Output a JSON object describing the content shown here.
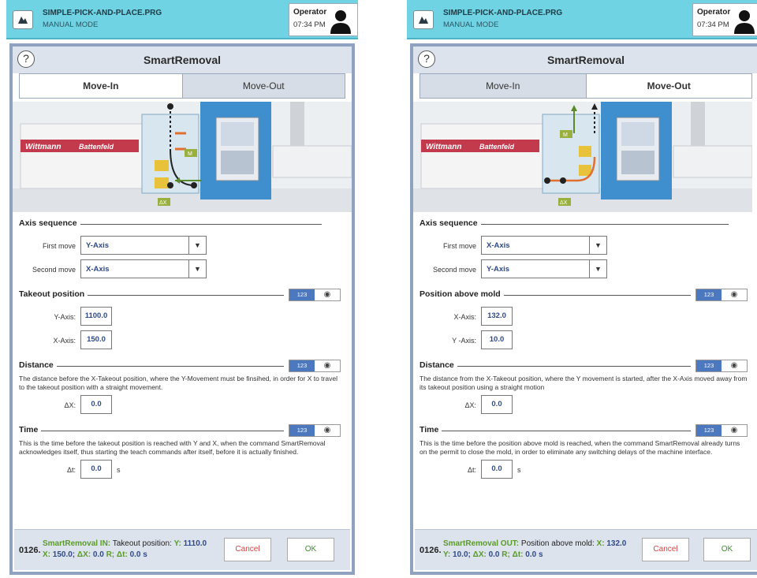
{
  "screens": [
    {
      "header": {
        "program": "SIMPLE-PICK-AND-PLACE.PRG",
        "mode": "MANUAL MODE",
        "role": "Operator",
        "time": "07:34 PM"
      },
      "dialog": {
        "title": "SmartRemoval",
        "help": "?",
        "tabs": [
          {
            "label": "Move-In",
            "active": true
          },
          {
            "label": "Move-Out",
            "active": false
          }
        ],
        "illustration": {
          "brand_left": "Wittmann",
          "brand_right": "Battenfeld",
          "marker_m": "M",
          "marker_dx": "ΔX"
        },
        "axis_sequence": {
          "heading": "Axis sequence",
          "first_label": "First move",
          "first_value": "Y-Axis",
          "second_label": "Second move",
          "second_value": "X-Axis"
        },
        "position": {
          "heading": "Takeout position",
          "toggle_a": "123",
          "toggle_b": "◉",
          "a_label": "Y-Axis:",
          "a_value": "1100.0",
          "b_label": "X-Axis:",
          "b_value": "150.0"
        },
        "distance": {
          "heading": "Distance",
          "toggle_a": "123",
          "toggle_b": "◉",
          "text": "The distance before the X-Takeout position, where the Y-Movement must be finsihed, in order for X to travel to the takeout position with a straight movement.",
          "label": "ΔX:",
          "value": "0.0"
        },
        "time": {
          "heading": "Time",
          "toggle_a": "123",
          "toggle_b": "◉",
          "text": "This is the time before the takeout position is reached with Y and X, when the command SmartRemoval acknowledges itself, thus starting the teach commands after itself, before it is actually finished.",
          "label": "Δt:",
          "value": "0.0",
          "unit": "s"
        },
        "footer": {
          "num": "0126.",
          "cmd": "SmartRemoval IN:",
          "desc": "Takeout position:",
          "p1": "Y:",
          "v1": "1110.0",
          "p2": "X:",
          "v2": "150.0;",
          "p3": "ΔX:",
          "v3": "0.0",
          "s3": "R;",
          "p4": "Δt:",
          "v4": "0.0",
          "s4": "s",
          "cancel": "Cancel",
          "ok": "OK"
        }
      }
    },
    {
      "header": {
        "program": "SIMPLE-PICK-AND-PLACE.PRG",
        "mode": "MANUAL MODE",
        "role": "Operator",
        "time": "07:34 PM"
      },
      "dialog": {
        "title": "SmartRemoval",
        "help": "?",
        "tabs": [
          {
            "label": "Move-In",
            "active": false
          },
          {
            "label": "Move-Out",
            "active": true
          }
        ],
        "illustration": {
          "brand_left": "Wittmann",
          "brand_right": "Battenfeld",
          "marker_m": "M",
          "marker_dx": "ΔX"
        },
        "axis_sequence": {
          "heading": "Axis sequence",
          "first_label": "First move",
          "first_value": "X-Axis",
          "second_label": "Second move",
          "second_value": "Y-Axis"
        },
        "position": {
          "heading": "Position above mold",
          "toggle_a": "123",
          "toggle_b": "◉",
          "a_label": "X-Axis:",
          "a_value": "132.0",
          "b_label": "Y -Axis:",
          "b_value": "10.0"
        },
        "distance": {
          "heading": "Distance",
          "toggle_a": "123",
          "toggle_b": "◉",
          "text": "The distance from the X-Takeout position, where the Y movement is started, after the X-Axis moved away from its takeout position using a straight motion",
          "label": "ΔX:",
          "value": "0.0"
        },
        "time": {
          "heading": "Time",
          "toggle_a": "123",
          "toggle_b": "◉",
          "text": "This is the time before the position above mold is reached, when the command SmartRemoval already turns on the permit to close the mold, in order to eliminate any switching delays of the machine interface.",
          "label": "Δt:",
          "value": "0.0",
          "unit": "s"
        },
        "footer": {
          "num": "0126.",
          "cmd": "SmartRemoval OUT:",
          "desc": "Position above mold:",
          "p1": "X:",
          "v1": "132.0",
          "p2": "Y:",
          "v2": "10.0;",
          "p3": "ΔX:",
          "v3": "0.0",
          "s3": "R;",
          "p4": "Δt:",
          "v4": "0.0",
          "s4": "s",
          "cancel": "Cancel",
          "ok": "OK"
        }
      }
    }
  ],
  "colors": {
    "header": "#6fd3e3",
    "accent": "#4b78bf",
    "value": "#2e4a88",
    "ok": "#3c8f2c",
    "cancel": "#d04545"
  },
  "icons": [
    "app-logo-icon",
    "user-avatar-icon",
    "help-icon",
    "dropdown-arrow-icon",
    "target-icon"
  ]
}
